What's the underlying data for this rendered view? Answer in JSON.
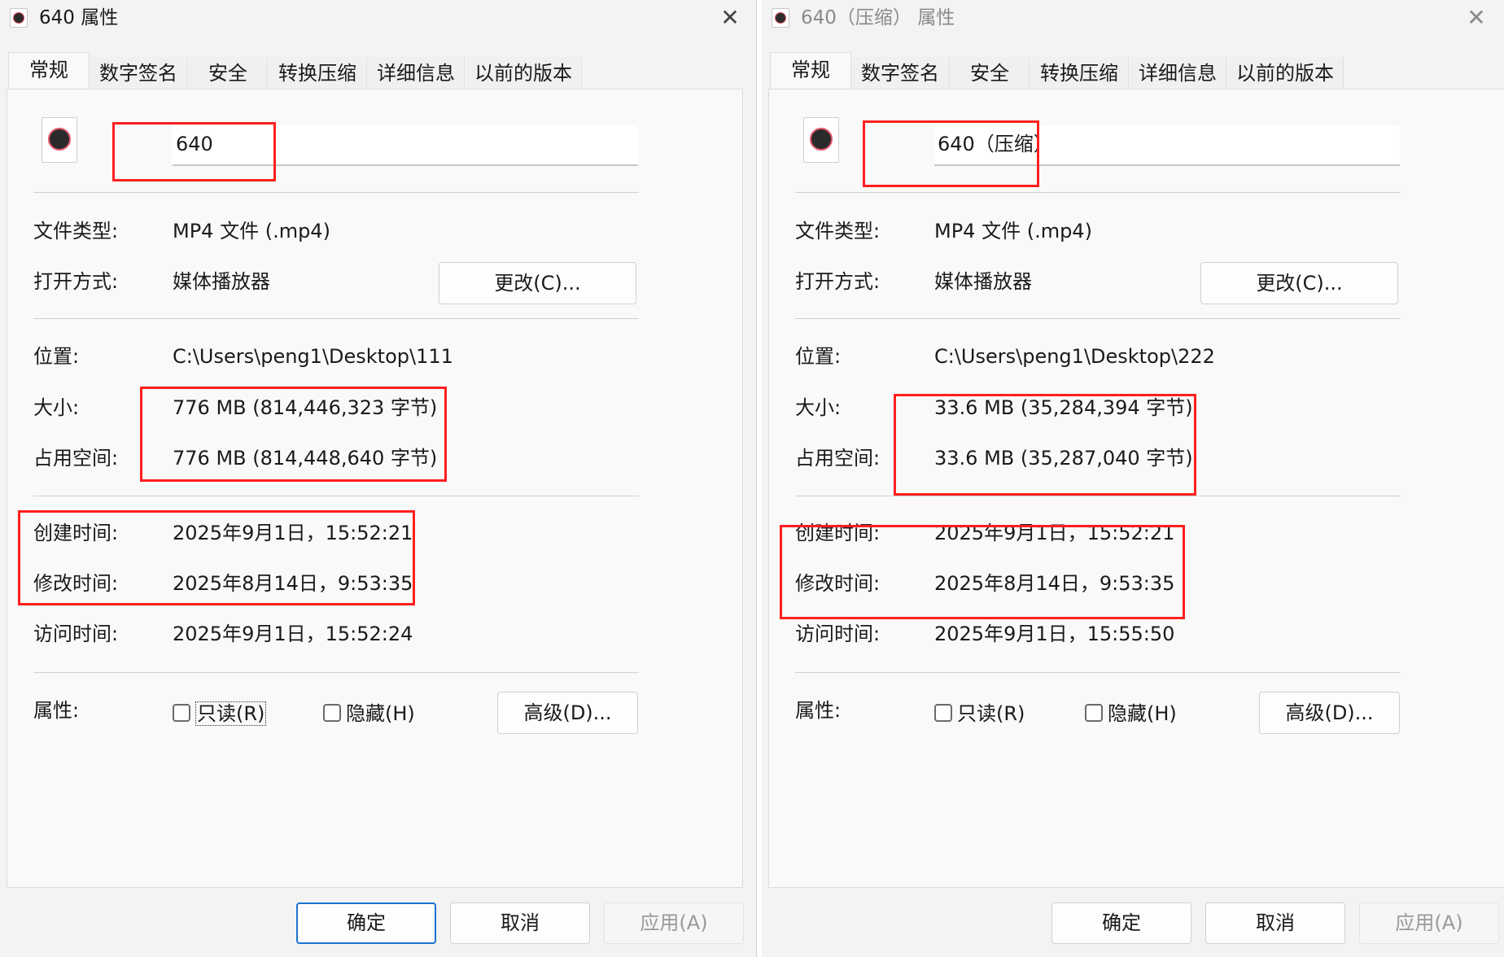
{
  "windows": [
    {
      "title": "640 属性",
      "close_icon": "close-icon",
      "tabs": [
        "常规",
        "数字签名",
        "安全",
        "转换压缩",
        "详细信息",
        "以前的版本"
      ],
      "active_tab": "常规",
      "file_name": "640",
      "labels": {
        "file_type": "文件类型:",
        "open_with": "打开方式:",
        "location": "位置:",
        "size": "大小:",
        "size_on_disk": "占用空间:",
        "created": "创建时间:",
        "modified": "修改时间:",
        "accessed": "访问时间:",
        "attributes": "属性:"
      },
      "file_type": "MP4 文件 (.mp4)",
      "open_with": "媒体播放器",
      "change_button": "更改(C)...",
      "location": "C:\\Users\\peng1\\Desktop\\111",
      "size": "776 MB (814,446,323 字节)",
      "size_on_disk": "776 MB (814,448,640 字节)",
      "created": "2025年9月1日，15:52:21",
      "modified": "2025年8月14日，9:53:35",
      "accessed": "2025年9月1日，15:52:24",
      "readonly_label": "只读(R)",
      "readonly_checked": false,
      "hidden_label": "隐藏(H)",
      "hidden_checked": false,
      "advanced_button": "高级(D)...",
      "ok_button": "确定",
      "cancel_button": "取消",
      "apply_button": "应用(A)"
    },
    {
      "title": "640（压缩） 属性",
      "close_icon": "close-icon",
      "tabs": [
        "常规",
        "数字签名",
        "安全",
        "转换压缩",
        "详细信息",
        "以前的版本"
      ],
      "active_tab": "常规",
      "file_name": "640（压缩）",
      "labels": {
        "file_type": "文件类型:",
        "open_with": "打开方式:",
        "location": "位置:",
        "size": "大小:",
        "size_on_disk": "占用空间:",
        "created": "创建时间:",
        "modified": "修改时间:",
        "accessed": "访问时间:",
        "attributes": "属性:"
      },
      "file_type": "MP4 文件 (.mp4)",
      "open_with": "媒体播放器",
      "change_button": "更改(C)...",
      "location": "C:\\Users\\peng1\\Desktop\\222",
      "size": "33.6 MB (35,284,394 字节)",
      "size_on_disk": "33.6 MB (35,287,040 字节)",
      "created": "2025年9月1日，15:52:21",
      "modified": "2025年8月14日，9:53:35",
      "accessed": "2025年9月1日，15:55:50",
      "readonly_label": "只读(R)",
      "readonly_checked": false,
      "hidden_label": "隐藏(H)",
      "hidden_checked": false,
      "advanced_button": "高级(D)...",
      "ok_button": "确定",
      "cancel_button": "取消",
      "apply_button": "应用(A)"
    }
  ],
  "annotation_color": "#ff1f1f",
  "accent_color": "#1a73d1"
}
